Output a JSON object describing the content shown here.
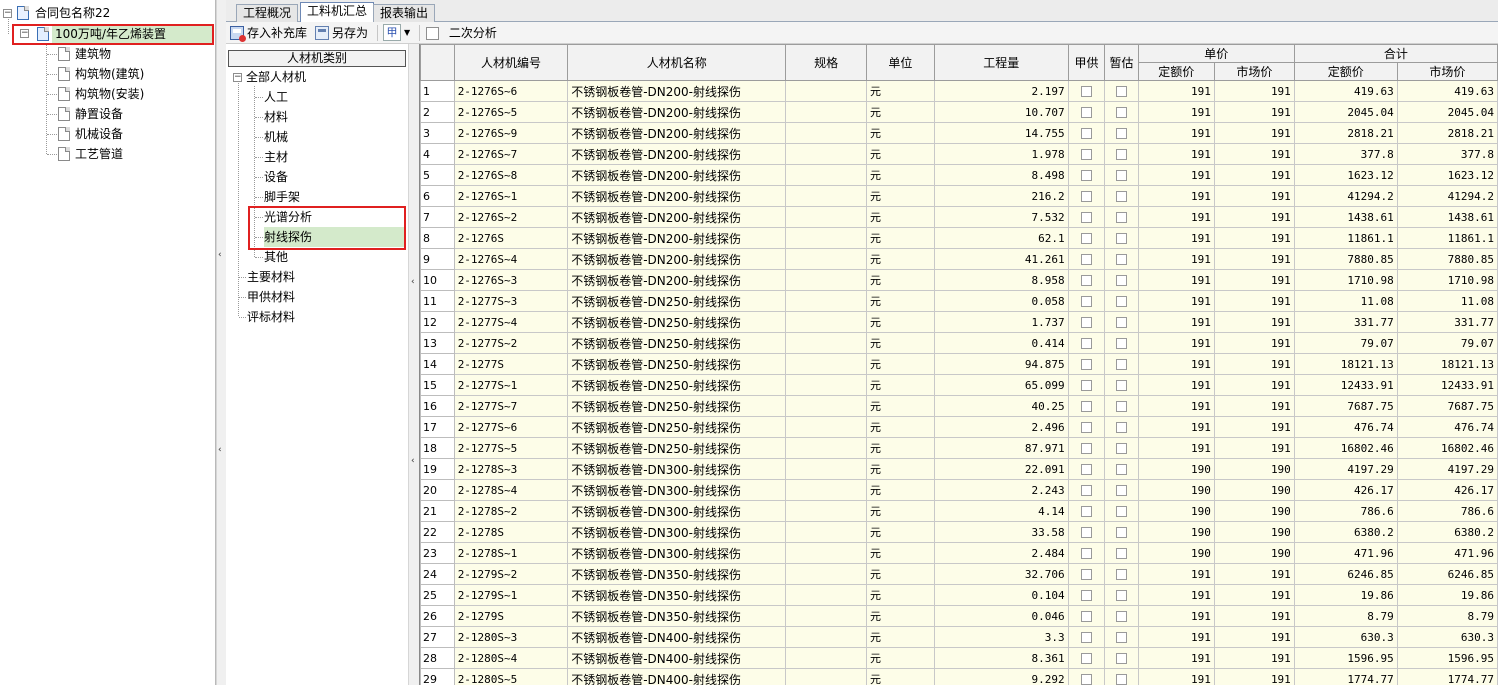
{
  "project_tree": {
    "root": "合同包名称22",
    "project": "100万吨/年乙烯装置",
    "children": [
      "建筑物",
      "构筑物(建筑)",
      "构筑物(安装)",
      "静置设备",
      "机械设备",
      "工艺管道"
    ]
  },
  "tabs": [
    "工程概况",
    "工料机汇总",
    "报表输出"
  ],
  "toolbar": {
    "save_to_library": "存入补充库",
    "save_as": "另存为",
    "grid_button": "甲",
    "secondary_analysis": "二次分析"
  },
  "category": {
    "header": "人材机类别",
    "all": "全部人材机",
    "items": [
      "人工",
      "材料",
      "机械",
      "主材",
      "设备",
      "脚手架",
      "光谱分析",
      "射线探伤",
      "其他"
    ],
    "top_items": [
      "主要材料",
      "甲供材料",
      "评标材料"
    ]
  },
  "grid": {
    "headers": {
      "code": "人材机编号",
      "name": "人材机名称",
      "spec": "规格",
      "unit": "单位",
      "qty": "工程量",
      "owner_supply": "甲供",
      "provisional": "暂估",
      "unit_price": "单价",
      "total": "合计",
      "quota_price": "定额价",
      "market_price": "市场价"
    },
    "rows": [
      {
        "n": "1",
        "code": "2-1276S~6",
        "name": "不锈钢板卷管-DN200-射线探伤",
        "unit": "元",
        "qty": "2.197",
        "qp": "191",
        "mp": "191",
        "qt": "419.63",
        "mt": "419.63"
      },
      {
        "n": "2",
        "code": "2-1276S~5",
        "name": "不锈钢板卷管-DN200-射线探伤",
        "unit": "元",
        "qty": "10.707",
        "qp": "191",
        "mp": "191",
        "qt": "2045.04",
        "mt": "2045.04"
      },
      {
        "n": "3",
        "code": "2-1276S~9",
        "name": "不锈钢板卷管-DN200-射线探伤",
        "unit": "元",
        "qty": "14.755",
        "qp": "191",
        "mp": "191",
        "qt": "2818.21",
        "mt": "2818.21"
      },
      {
        "n": "4",
        "code": "2-1276S~7",
        "name": "不锈钢板卷管-DN200-射线探伤",
        "unit": "元",
        "qty": "1.978",
        "qp": "191",
        "mp": "191",
        "qt": "377.8",
        "mt": "377.8"
      },
      {
        "n": "5",
        "code": "2-1276S~8",
        "name": "不锈钢板卷管-DN200-射线探伤",
        "unit": "元",
        "qty": "8.498",
        "qp": "191",
        "mp": "191",
        "qt": "1623.12",
        "mt": "1623.12"
      },
      {
        "n": "6",
        "code": "2-1276S~1",
        "name": "不锈钢板卷管-DN200-射线探伤",
        "unit": "元",
        "qty": "216.2",
        "qp": "191",
        "mp": "191",
        "qt": "41294.2",
        "mt": "41294.2"
      },
      {
        "n": "7",
        "code": "2-1276S~2",
        "name": "不锈钢板卷管-DN200-射线探伤",
        "unit": "元",
        "qty": "7.532",
        "qp": "191",
        "mp": "191",
        "qt": "1438.61",
        "mt": "1438.61"
      },
      {
        "n": "8",
        "code": "2-1276S",
        "name": "不锈钢板卷管-DN200-射线探伤",
        "unit": "元",
        "qty": "62.1",
        "qp": "191",
        "mp": "191",
        "qt": "11861.1",
        "mt": "11861.1"
      },
      {
        "n": "9",
        "code": "2-1276S~4",
        "name": "不锈钢板卷管-DN200-射线探伤",
        "unit": "元",
        "qty": "41.261",
        "qp": "191",
        "mp": "191",
        "qt": "7880.85",
        "mt": "7880.85"
      },
      {
        "n": "10",
        "code": "2-1276S~3",
        "name": "不锈钢板卷管-DN200-射线探伤",
        "unit": "元",
        "qty": "8.958",
        "qp": "191",
        "mp": "191",
        "qt": "1710.98",
        "mt": "1710.98"
      },
      {
        "n": "11",
        "code": "2-1277S~3",
        "name": "不锈钢板卷管-DN250-射线探伤",
        "unit": "元",
        "qty": "0.058",
        "qp": "191",
        "mp": "191",
        "qt": "11.08",
        "mt": "11.08"
      },
      {
        "n": "12",
        "code": "2-1277S~4",
        "name": "不锈钢板卷管-DN250-射线探伤",
        "unit": "元",
        "qty": "1.737",
        "qp": "191",
        "mp": "191",
        "qt": "331.77",
        "mt": "331.77"
      },
      {
        "n": "13",
        "code": "2-1277S~2",
        "name": "不锈钢板卷管-DN250-射线探伤",
        "unit": "元",
        "qty": "0.414",
        "qp": "191",
        "mp": "191",
        "qt": "79.07",
        "mt": "79.07"
      },
      {
        "n": "14",
        "code": "2-1277S",
        "name": "不锈钢板卷管-DN250-射线探伤",
        "unit": "元",
        "qty": "94.875",
        "qp": "191",
        "mp": "191",
        "qt": "18121.13",
        "mt": "18121.13"
      },
      {
        "n": "15",
        "code": "2-1277S~1",
        "name": "不锈钢板卷管-DN250-射线探伤",
        "unit": "元",
        "qty": "65.099",
        "qp": "191",
        "mp": "191",
        "qt": "12433.91",
        "mt": "12433.91"
      },
      {
        "n": "16",
        "code": "2-1277S~7",
        "name": "不锈钢板卷管-DN250-射线探伤",
        "unit": "元",
        "qty": "40.25",
        "qp": "191",
        "mp": "191",
        "qt": "7687.75",
        "mt": "7687.75"
      },
      {
        "n": "17",
        "code": "2-1277S~6",
        "name": "不锈钢板卷管-DN250-射线探伤",
        "unit": "元",
        "qty": "2.496",
        "qp": "191",
        "mp": "191",
        "qt": "476.74",
        "mt": "476.74"
      },
      {
        "n": "18",
        "code": "2-1277S~5",
        "name": "不锈钢板卷管-DN250-射线探伤",
        "unit": "元",
        "qty": "87.971",
        "qp": "191",
        "mp": "191",
        "qt": "16802.46",
        "mt": "16802.46"
      },
      {
        "n": "19",
        "code": "2-1278S~3",
        "name": "不锈钢板卷管-DN300-射线探伤",
        "unit": "元",
        "qty": "22.091",
        "qp": "190",
        "mp": "190",
        "qt": "4197.29",
        "mt": "4197.29"
      },
      {
        "n": "20",
        "code": "2-1278S~4",
        "name": "不锈钢板卷管-DN300-射线探伤",
        "unit": "元",
        "qty": "2.243",
        "qp": "190",
        "mp": "190",
        "qt": "426.17",
        "mt": "426.17"
      },
      {
        "n": "21",
        "code": "2-1278S~2",
        "name": "不锈钢板卷管-DN300-射线探伤",
        "unit": "元",
        "qty": "4.14",
        "qp": "190",
        "mp": "190",
        "qt": "786.6",
        "mt": "786.6"
      },
      {
        "n": "22",
        "code": "2-1278S",
        "name": "不锈钢板卷管-DN300-射线探伤",
        "unit": "元",
        "qty": "33.58",
        "qp": "190",
        "mp": "190",
        "qt": "6380.2",
        "mt": "6380.2"
      },
      {
        "n": "23",
        "code": "2-1278S~1",
        "name": "不锈钢板卷管-DN300-射线探伤",
        "unit": "元",
        "qty": "2.484",
        "qp": "190",
        "mp": "190",
        "qt": "471.96",
        "mt": "471.96"
      },
      {
        "n": "24",
        "code": "2-1279S~2",
        "name": "不锈钢板卷管-DN350-射线探伤",
        "unit": "元",
        "qty": "32.706",
        "qp": "191",
        "mp": "191",
        "qt": "6246.85",
        "mt": "6246.85"
      },
      {
        "n": "25",
        "code": "2-1279S~1",
        "name": "不锈钢板卷管-DN350-射线探伤",
        "unit": "元",
        "qty": "0.104",
        "qp": "191",
        "mp": "191",
        "qt": "19.86",
        "mt": "19.86"
      },
      {
        "n": "26",
        "code": "2-1279S",
        "name": "不锈钢板卷管-DN350-射线探伤",
        "unit": "元",
        "qty": "0.046",
        "qp": "191",
        "mp": "191",
        "qt": "8.79",
        "mt": "8.79"
      },
      {
        "n": "27",
        "code": "2-1280S~3",
        "name": "不锈钢板卷管-DN400-射线探伤",
        "unit": "元",
        "qty": "3.3",
        "qp": "191",
        "mp": "191",
        "qt": "630.3",
        "mt": "630.3"
      },
      {
        "n": "28",
        "code": "2-1280S~4",
        "name": "不锈钢板卷管-DN400-射线探伤",
        "unit": "元",
        "qty": "8.361",
        "qp": "191",
        "mp": "191",
        "qt": "1596.95",
        "mt": "1596.95"
      },
      {
        "n": "29",
        "code": "2-1280S~5",
        "name": "不锈钢板卷管-DN400-射线探伤",
        "unit": "元",
        "qty": "9.292",
        "qp": "191",
        "mp": "191",
        "qt": "1774.77",
        "mt": "1774.77"
      }
    ]
  },
  "colors": {
    "selected_bg": "#d4eacb",
    "highlight_frame": "#e02020",
    "cell_bg": "#fdfde8"
  }
}
